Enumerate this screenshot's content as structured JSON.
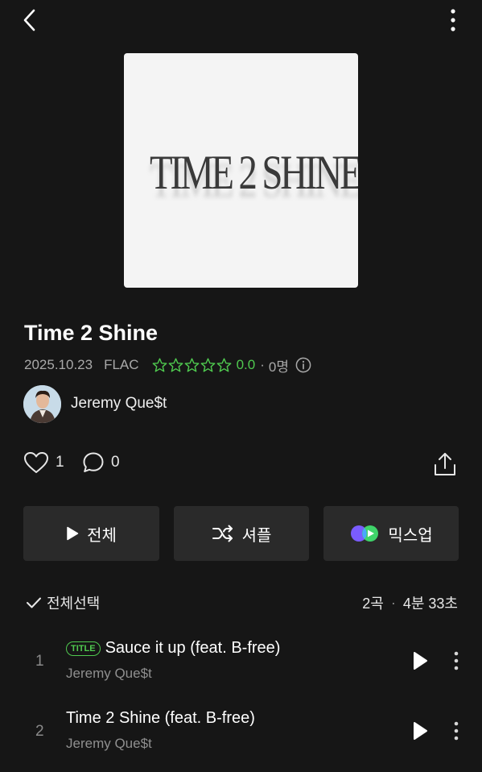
{
  "icons": {
    "back": "chevron-left-icon",
    "more": "more-vertical-icon",
    "info": "info-icon",
    "heart": "heart-icon",
    "comment": "comment-icon",
    "share": "share-icon",
    "play": "play-icon",
    "shuffle": "shuffle-icon",
    "mixup": "mixup-icon",
    "check": "check-icon"
  },
  "album": {
    "art_text": "TIME 2 SHINE",
    "title": "Time 2 Shine",
    "date": "2025.10.23",
    "format": "FLAC",
    "rating": "0.0",
    "rating_stars": 0,
    "raters": "0명"
  },
  "artist": {
    "name": "Jeremy Que$t"
  },
  "actions": {
    "likes": "1",
    "comments": "0"
  },
  "buttons": {
    "play_all": "전체",
    "shuffle": "셔플",
    "mixup": "믹스업"
  },
  "tracklist": {
    "select_all": "전체선택",
    "count": "2곡",
    "duration": "4분 33초",
    "tracks": [
      {
        "num": "1",
        "badge": "TITLE",
        "title": "Sauce it up (feat. B-free)",
        "artist": "Jeremy Que$t"
      },
      {
        "num": "2",
        "title": "Time 2 Shine (feat. B-free)",
        "artist": "Jeremy Que$t"
      }
    ]
  },
  "colors": {
    "background": "#161616",
    "accent_green": "#4fc94f",
    "button_bg": "#2a2a2a",
    "muted_text": "#a9a9a9"
  }
}
